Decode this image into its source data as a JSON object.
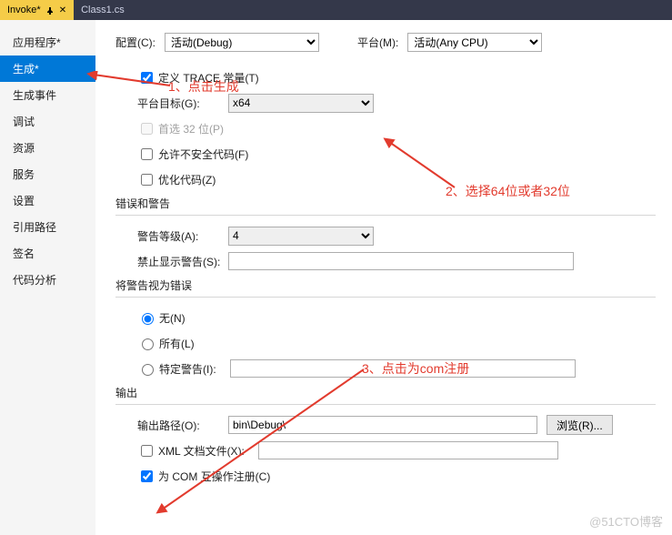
{
  "tabs": [
    {
      "label": "Invoke*",
      "active": true
    },
    {
      "label": "Class1.cs",
      "active": false
    }
  ],
  "sidebar": {
    "items": [
      "应用程序*",
      "生成*",
      "生成事件",
      "调试",
      "资源",
      "服务",
      "设置",
      "引用路径",
      "签名",
      "代码分析"
    ],
    "selected": 1
  },
  "top": {
    "config_label": "配置(C):",
    "config_value": "活动(Debug)",
    "platform_label": "平台(M):",
    "platform_value": "活动(Any CPU)"
  },
  "general": {
    "trace_label": "定义 TRACE 常量(T)",
    "trace_checked": true,
    "target_label": "平台目标(G):",
    "target_value": "x64",
    "prefer32_label": "首选 32 位(P)",
    "prefer32_checked": false,
    "unsafe_label": "允许不安全代码(F)",
    "unsafe_checked": false,
    "optimize_label": "优化代码(Z)",
    "optimize_checked": false
  },
  "errors": {
    "title": "错误和警告",
    "level_label": "警告等级(A):",
    "level_value": "4",
    "suppress_label": "禁止显示警告(S):",
    "suppress_value": ""
  },
  "treat": {
    "title": "将警告视为错误",
    "none": "无(N)",
    "all": "所有(L)",
    "specific": "特定警告(I):",
    "specific_value": "",
    "selected": "none"
  },
  "output": {
    "title": "输出",
    "path_label": "输出路径(O):",
    "path_value": "bin\\Debug\\",
    "browse": "浏览(R)...",
    "xml_label": "XML 文档文件(X):",
    "xml_checked": false,
    "xml_value": "",
    "com_label": "为 COM 互操作注册(C)",
    "com_checked": true
  },
  "annotations": {
    "a1": "1、点击生成",
    "a2": "2、选择64位或者32位",
    "a3": "3、点击为com注册"
  },
  "watermark": "@51CTO博客"
}
